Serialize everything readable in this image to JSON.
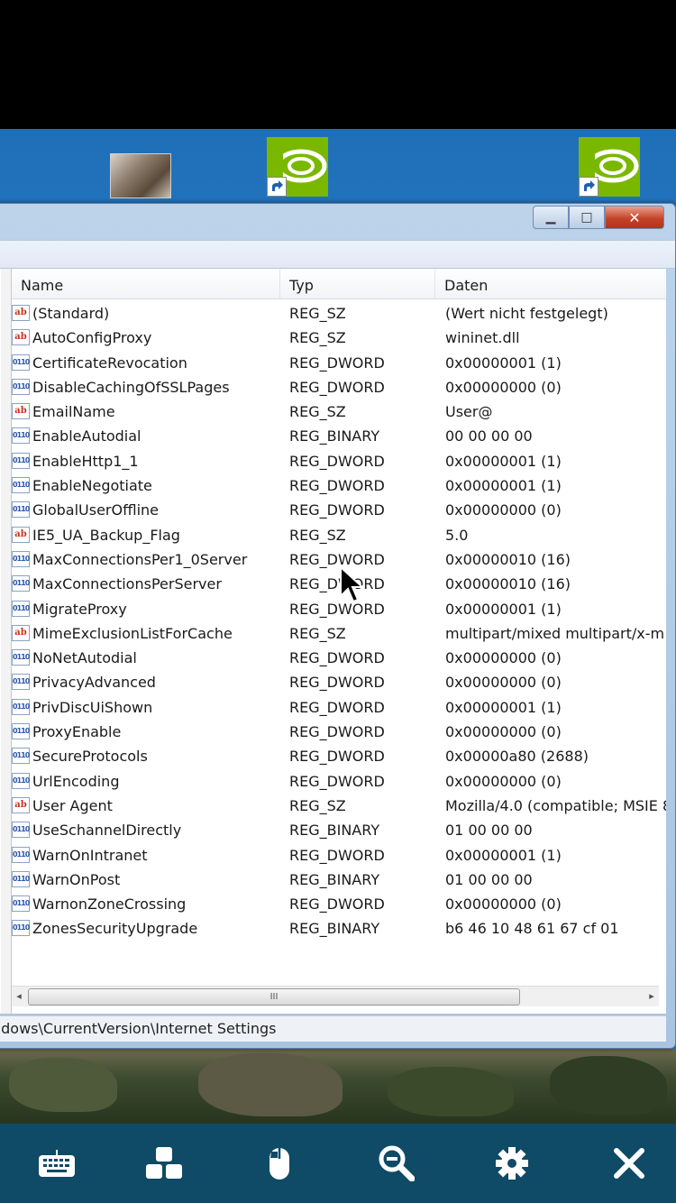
{
  "registry": {
    "columns": {
      "name": "Name",
      "type": "Typ",
      "data": "Daten"
    },
    "values": [
      {
        "icon": "string-value-icon",
        "name": "(Standard)",
        "type": "REG_SZ",
        "data": "(Wert nicht festgelegt)"
      },
      {
        "icon": "string-value-icon",
        "name": "AutoConfigProxy",
        "type": "REG_SZ",
        "data": "wininet.dll"
      },
      {
        "icon": "binary-value-icon",
        "name": "CertificateRevocation",
        "type": "REG_DWORD",
        "data": "0x00000001 (1)"
      },
      {
        "icon": "binary-value-icon",
        "name": "DisableCachingOfSSLPages",
        "type": "REG_DWORD",
        "data": "0x00000000 (0)"
      },
      {
        "icon": "string-value-icon",
        "name": "EmailName",
        "type": "REG_SZ",
        "data": "User@"
      },
      {
        "icon": "binary-value-icon",
        "name": "EnableAutodial",
        "type": "REG_BINARY",
        "data": "00 00 00 00"
      },
      {
        "icon": "binary-value-icon",
        "name": "EnableHttp1_1",
        "type": "REG_DWORD",
        "data": "0x00000001 (1)"
      },
      {
        "icon": "binary-value-icon",
        "name": "EnableNegotiate",
        "type": "REG_DWORD",
        "data": "0x00000001 (1)"
      },
      {
        "icon": "binary-value-icon",
        "name": "GlobalUserOffline",
        "type": "REG_DWORD",
        "data": "0x00000000 (0)"
      },
      {
        "icon": "string-value-icon",
        "name": "IE5_UA_Backup_Flag",
        "type": "REG_SZ",
        "data": "5.0"
      },
      {
        "icon": "binary-value-icon",
        "name": "MaxConnectionsPer1_0Server",
        "type": "REG_DWORD",
        "data": "0x00000010 (16)"
      },
      {
        "icon": "binary-value-icon",
        "name": "MaxConnectionsPerServer",
        "type": "REG_DWORD",
        "data": "0x00000010 (16)"
      },
      {
        "icon": "binary-value-icon",
        "name": "MigrateProxy",
        "type": "REG_DWORD",
        "data": "0x00000001 (1)"
      },
      {
        "icon": "string-value-icon",
        "name": "MimeExclusionListForCache",
        "type": "REG_SZ",
        "data": "multipart/mixed multipart/x-m"
      },
      {
        "icon": "binary-value-icon",
        "name": "NoNetAutodial",
        "type": "REG_DWORD",
        "data": "0x00000000 (0)"
      },
      {
        "icon": "binary-value-icon",
        "name": "PrivacyAdvanced",
        "type": "REG_DWORD",
        "data": "0x00000000 (0)"
      },
      {
        "icon": "binary-value-icon",
        "name": "PrivDiscUiShown",
        "type": "REG_DWORD",
        "data": "0x00000001 (1)"
      },
      {
        "icon": "binary-value-icon",
        "name": "ProxyEnable",
        "type": "REG_DWORD",
        "data": "0x00000000 (0)"
      },
      {
        "icon": "binary-value-icon",
        "name": "SecureProtocols",
        "type": "REG_DWORD",
        "data": "0x00000a80 (2688)"
      },
      {
        "icon": "binary-value-icon",
        "name": "UrlEncoding",
        "type": "REG_DWORD",
        "data": "0x00000000 (0)"
      },
      {
        "icon": "string-value-icon",
        "name": "User Agent",
        "type": "REG_SZ",
        "data": "Mozilla/4.0 (compatible; MSIE 8"
      },
      {
        "icon": "binary-value-icon",
        "name": "UseSchannelDirectly",
        "type": "REG_BINARY",
        "data": "01 00 00 00"
      },
      {
        "icon": "binary-value-icon",
        "name": "WarnOnIntranet",
        "type": "REG_DWORD",
        "data": "0x00000001 (1)"
      },
      {
        "icon": "binary-value-icon",
        "name": "WarnOnPost",
        "type": "REG_BINARY",
        "data": "01 00 00 00"
      },
      {
        "icon": "binary-value-icon",
        "name": "WarnonZoneCrossing",
        "type": "REG_DWORD",
        "data": "0x00000000 (0)"
      },
      {
        "icon": "binary-value-icon",
        "name": "ZonesSecurityUpgrade",
        "type": "REG_BINARY",
        "data": "b6 46 10 48 61 67 cf 01"
      }
    ],
    "status_path": "ndows\\CurrentVersion\\Internet Settings",
    "scroll_grip": "III"
  },
  "window_controls": {
    "minimize": "▁",
    "maximize": "□",
    "close": "✕"
  },
  "toolbar": {
    "items": [
      {
        "icon": "keyboard-icon"
      },
      {
        "icon": "dashboard-icon"
      },
      {
        "icon": "mouse-icon"
      },
      {
        "icon": "zoom-out-icon"
      },
      {
        "icon": "gear-icon"
      },
      {
        "icon": "close-icon"
      }
    ]
  },
  "colors": {
    "toolbar_bg": "#0f4a66",
    "nvidia_green": "#7ab800"
  }
}
